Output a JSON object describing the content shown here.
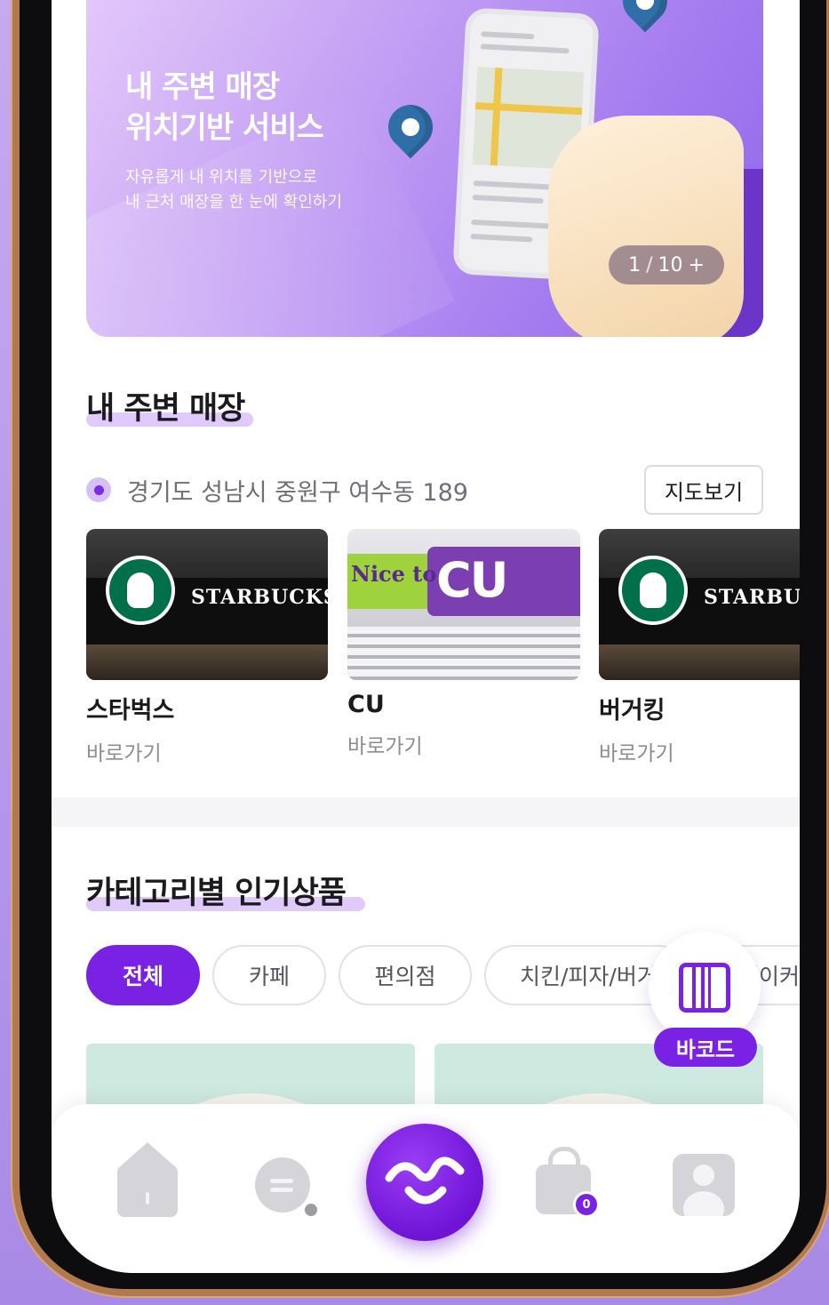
{
  "banner": {
    "title_line1": "내 주변 매장",
    "title_line2": "위치기반 서비스",
    "sub_line1": "자유롭게 내 위치를 기반으로",
    "sub_line2": "내 근처 매장을 한 눈에 확인하기",
    "pager_current": "1",
    "pager_sep": "/",
    "pager_total": "10",
    "pager_more": "+"
  },
  "nearby": {
    "title": "내 주변 매장",
    "location": "경기도 성남시 중원구 여수동 189",
    "map_button": "지도보기",
    "stores": [
      {
        "name": "스타벅스",
        "link": "바로가기",
        "sign": "STARBUCKS"
      },
      {
        "name": "CU",
        "link": "바로가기",
        "sign_nice": "Nice to",
        "sign_cu": "CU"
      },
      {
        "name": "버거킹",
        "link": "바로가기",
        "sign": "STARBUCKS"
      }
    ]
  },
  "category": {
    "title": "카테고리별 인기상품",
    "chips": [
      "전체",
      "카페",
      "편의점",
      "치킨/피자/버거",
      "베이커리"
    ],
    "active_chip": "전체"
  },
  "barcode": {
    "label": "바코드"
  },
  "bottom_nav": {
    "items": [
      "home-icon",
      "chat-icon",
      "center-logo-icon",
      "bag-icon",
      "profile-icon"
    ],
    "bag_badge": "0"
  },
  "colors": {
    "accent": "#7a22e3",
    "background": "#b596ea",
    "banner_start": "#e3c9fa",
    "banner_end": "#8f67ea"
  }
}
